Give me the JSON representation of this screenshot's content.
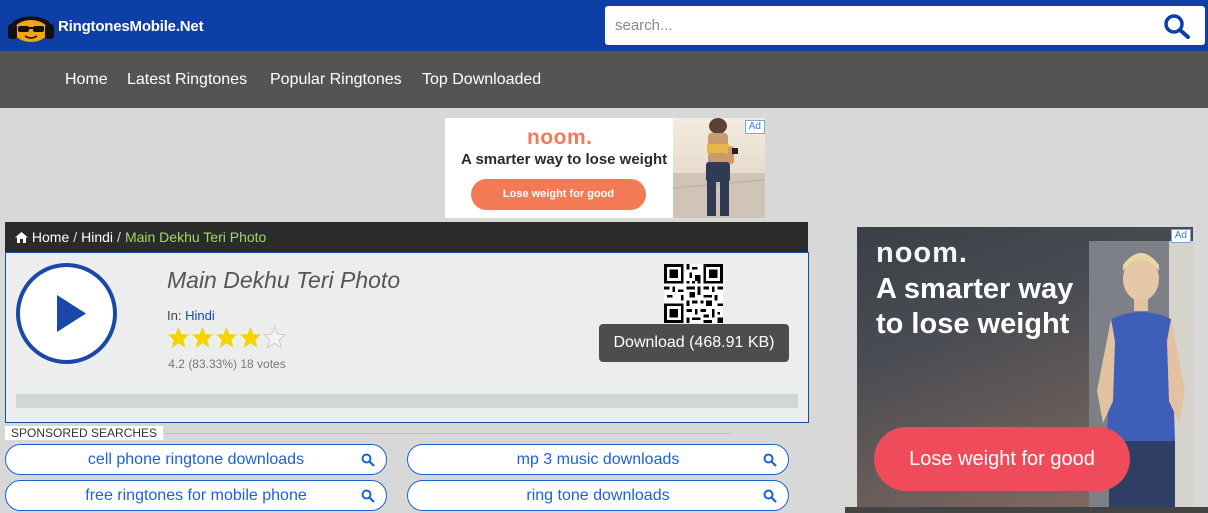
{
  "site": {
    "name": "RingtonesMobile.Net"
  },
  "search": {
    "placeholder": "search...",
    "button_icon": "search-icon"
  },
  "nav": {
    "items": [
      {
        "label": "Home"
      },
      {
        "label": "Latest Ringtones"
      },
      {
        "label": "Popular Ringtones"
      },
      {
        "label": "Top Downloaded"
      }
    ]
  },
  "ad_top": {
    "badge": "Ad",
    "brand": "noom.",
    "tagline": "A smarter way to lose weight",
    "button": "Lose weight for good"
  },
  "breadcrumb": {
    "home": "Home",
    "category": "Hindi",
    "current": "Main Dekhu Teri Photo",
    "separator": "/"
  },
  "song": {
    "title": "Main Dekhu Teri Photo",
    "in_label": "In:",
    "category": "Hindi",
    "rating_stars": 4.2,
    "rating_text": "4.2 (83.33%) 18 votes",
    "download_label": "Download (468.91 KB)"
  },
  "sponsored": {
    "label": "SPONSORED SEARCHES",
    "items": [
      {
        "label": "cell phone ringtone downloads"
      },
      {
        "label": "mp 3 music downloads"
      },
      {
        "label": "free ringtones for mobile phone"
      },
      {
        "label": "ring tone downloads"
      }
    ]
  },
  "ad_right": {
    "badge": "Ad",
    "brand": "noom.",
    "tagline_line1": "A smarter way",
    "tagline_line2": "to lose weight",
    "button": "Lose weight for good"
  },
  "colors": {
    "header_bg": "#0d3fa6",
    "nav_bg": "#545454",
    "accent": "#1a47a8",
    "breadcrumb_current": "#9fd96b",
    "star": "#f5d300"
  }
}
